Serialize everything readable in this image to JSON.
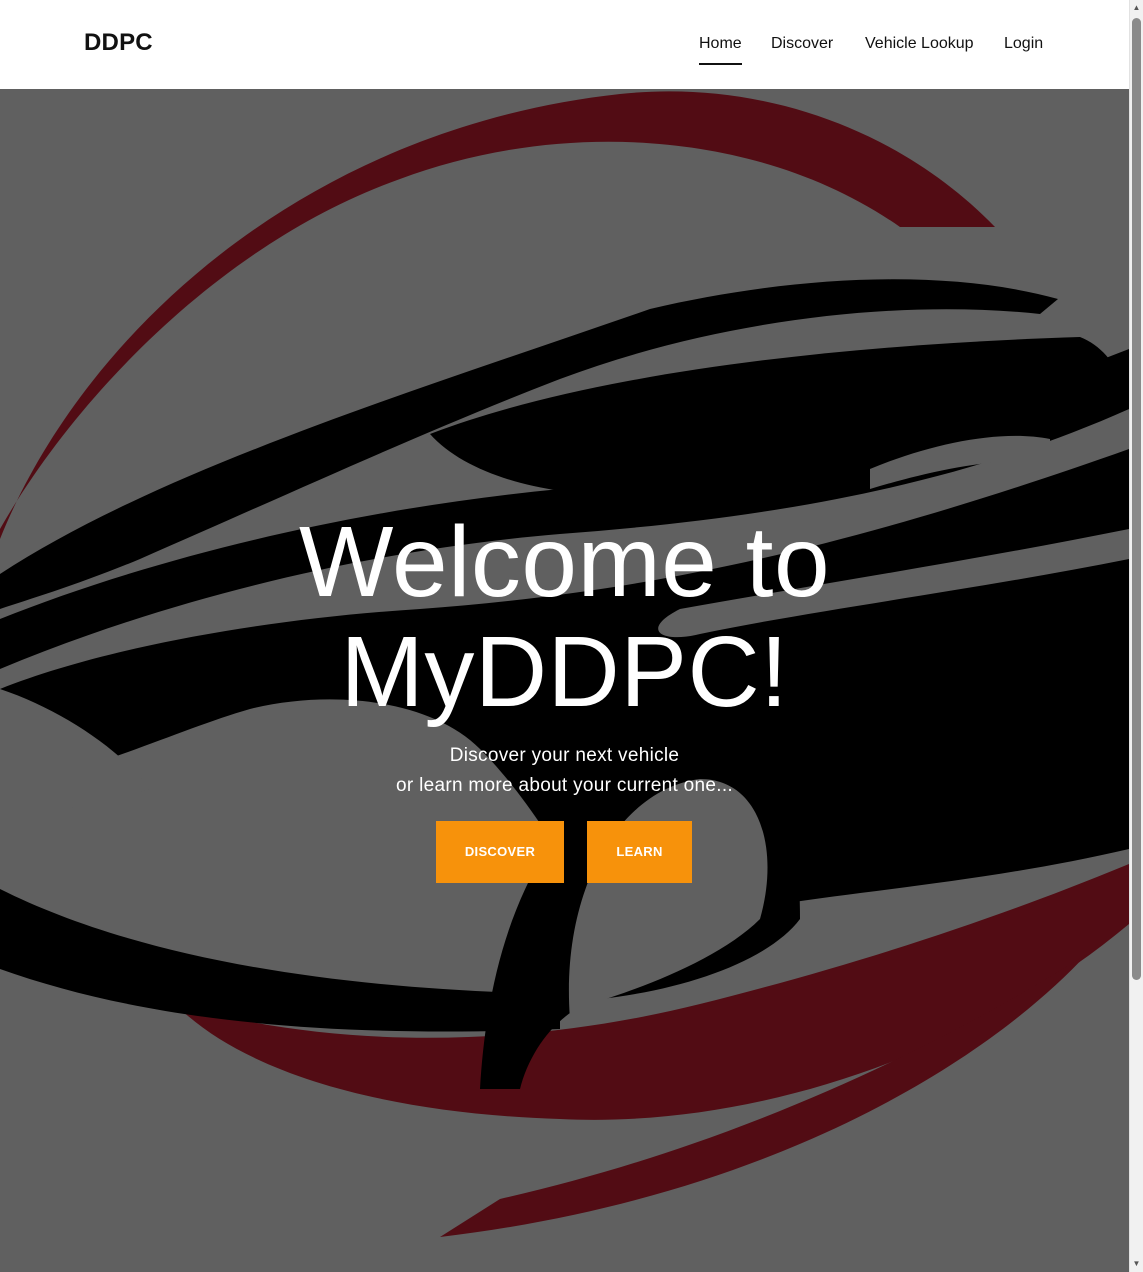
{
  "navbar": {
    "brand": "DDPC",
    "links": [
      {
        "label": "Home",
        "active": true
      },
      {
        "label": "Discover",
        "active": false
      },
      {
        "label": "Vehicle Lookup",
        "active": false
      },
      {
        "label": "Login",
        "active": false
      }
    ]
  },
  "hero": {
    "title_line1": "Welcome to",
    "title_line2": "MyDDPC!",
    "subtitle_line1": "Discover your next vehicle",
    "subtitle_line2": "or learn more about your current one...",
    "buttons": {
      "discover": "DISCOVER",
      "learn": "LEARN"
    },
    "background_image": "car-logo-illustration"
  },
  "colors": {
    "accent": "#f7920b",
    "hero_overlay": "#606060",
    "logo_red": "#520c14",
    "logo_black": "#000000",
    "nav_text": "#111111"
  },
  "scrollbar": {
    "up_icon": "▲",
    "down_icon": "▼"
  }
}
